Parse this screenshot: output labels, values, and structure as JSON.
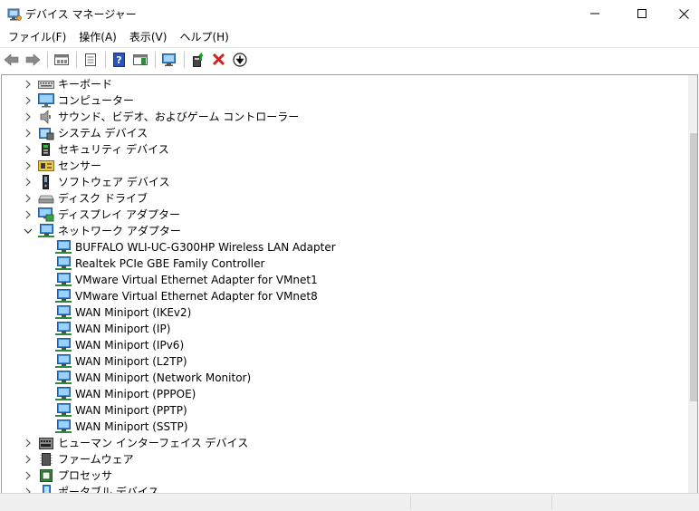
{
  "window": {
    "title": "デバイス マネージャー",
    "accent": "#0078d7"
  },
  "menu": [
    {
      "label": "ファイル(F)"
    },
    {
      "label": "操作(A)"
    },
    {
      "label": "表示(V)"
    },
    {
      "label": "ヘルプ(H)"
    }
  ],
  "toolbar": [
    {
      "icon": "back-arrow-icon"
    },
    {
      "icon": "forward-arrow-icon"
    },
    {
      "icon": "properties-icon"
    },
    {
      "icon": "view-list-icon"
    },
    {
      "icon": "help-icon"
    },
    {
      "icon": "action-pane-icon"
    },
    {
      "icon": "scan-hardware-icon"
    },
    {
      "icon": "update-driver-icon"
    },
    {
      "icon": "uninstall-device-icon"
    },
    {
      "icon": "download-icon"
    }
  ],
  "tree": {
    "categories_before": [
      {
        "label": "キーボード",
        "icon": "keyboard-icon"
      },
      {
        "label": "コンピューター",
        "icon": "computer-icon"
      },
      {
        "label": "サウンド、ビデオ、およびゲーム コントローラー",
        "icon": "speaker-icon"
      },
      {
        "label": "システム デバイス",
        "icon": "system-device-icon"
      },
      {
        "label": "セキュリティ デバイス",
        "icon": "security-device-icon"
      },
      {
        "label": "センサー",
        "icon": "sensor-icon"
      },
      {
        "label": "ソフトウェア デバイス",
        "icon": "software-device-icon"
      },
      {
        "label": "ディスク ドライブ",
        "icon": "disk-drive-icon"
      },
      {
        "label": "ディスプレイ アダプター",
        "icon": "display-adapter-icon"
      }
    ],
    "expanded": {
      "label": "ネットワーク アダプター",
      "icon": "network-adapter-icon",
      "children": [
        "BUFFALO WLI-UC-G300HP Wireless LAN Adapter",
        "Realtek PCIe GBE Family Controller",
        "VMware Virtual Ethernet Adapter for VMnet1",
        "VMware Virtual Ethernet Adapter for VMnet8",
        "WAN Miniport (IKEv2)",
        "WAN Miniport (IP)",
        "WAN Miniport (IPv6)",
        "WAN Miniport (L2TP)",
        "WAN Miniport (Network Monitor)",
        "WAN Miniport (PPPOE)",
        "WAN Miniport (PPTP)",
        "WAN Miniport (SSTP)"
      ]
    },
    "categories_after": [
      {
        "label": "ヒューマン インターフェイス デバイス",
        "icon": "hid-icon"
      },
      {
        "label": "ファームウェア",
        "icon": "firmware-icon"
      },
      {
        "label": "プロセッサ",
        "icon": "processor-icon"
      },
      {
        "label": "ポータブル デバイス",
        "icon": "portable-device-icon"
      }
    ]
  }
}
